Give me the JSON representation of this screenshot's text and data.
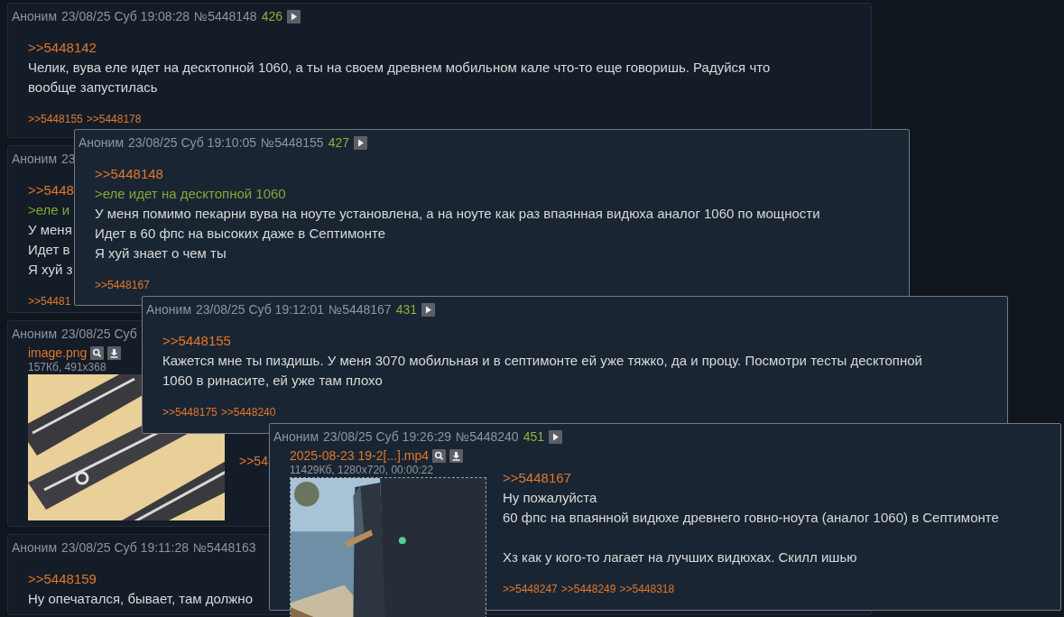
{
  "thread": [
    {
      "author": "Аноним",
      "datetime": "23/08/25 Суб 19:08:28",
      "number": "№5448148",
      "ordinal": "426",
      "reply_to": ">>5448142",
      "lines": [
        {
          "kind": "text",
          "text": "Челик, вува еле идет на десктопной 1060, а ты на своем древнем мобильном кале что-то еще говоришь. Радуйся что вообще запустилась"
        }
      ],
      "backlinks": [
        ">>5448155",
        ">>5448178"
      ]
    },
    {
      "author": "Аноним",
      "datetime": "23",
      "reply_to": ">>5448",
      "lines": [
        {
          "kind": "quote",
          "text": ">еле и"
        },
        {
          "kind": "text",
          "text": "У меня"
        },
        {
          "kind": "text",
          "text": "Идет в"
        },
        {
          "kind": "text",
          "text": "Я хуй з"
        }
      ],
      "backlinks": [
        ">>54481"
      ]
    },
    {
      "author": "Аноним",
      "datetime": "23/08/25 Суб",
      "file": {
        "name": "image.png",
        "meta": "157Кб, 491x368"
      },
      "reply_to": ">>54"
    },
    {
      "author": "Аноним",
      "datetime": "23/08/25 Суб 19:11:28",
      "number": "№5448163",
      "reply_to": ">>5448159",
      "lines": [
        {
          "kind": "text",
          "text": "Ну опечатался, бывает, там должно"
        }
      ]
    }
  ],
  "previews": [
    {
      "author": "Аноним",
      "datetime": "23/08/25 Суб 19:10:05",
      "number": "№5448155",
      "ordinal": "427",
      "reply_to": ">>5448148",
      "lines": [
        {
          "kind": "quote",
          "text": ">еле идет на десктопной 1060"
        },
        {
          "kind": "text",
          "text": "У меня помимо пекарни вува на ноуте установлена, а на ноуте как раз впаянная видюха аналог 1060 по мощности"
        },
        {
          "kind": "text",
          "text": "Идет в 60 фпс на высоких даже в Септимонте"
        },
        {
          "kind": "text",
          "text": "Я хуй знает о чем ты"
        }
      ],
      "backlinks": [
        ">>5448167"
      ]
    },
    {
      "author": "Аноним",
      "datetime": "23/08/25 Суб 19:12:01",
      "number": "№5448167",
      "ordinal": "431",
      "reply_to": ">>5448155",
      "lines": [
        {
          "kind": "text",
          "text": "Кажется мне ты пиздишь. У меня 3070 мобильная и в септимонте ей уже тяжко, да и процу. Посмотри тесты десктопной 1060 в ринасите, ей уже там плохо"
        }
      ],
      "backlinks": [
        ">>5448175",
        ">>5448240"
      ]
    },
    {
      "author": "Аноним",
      "datetime": "23/08/25 Суб 19:26:29",
      "number": "№5448240",
      "ordinal": "451",
      "file": {
        "kind": "video",
        "name": "2025-08-23 19-2[...].mp4",
        "meta": "11429Кб, 1280x720, 00:00:22"
      },
      "reply_to": ">>5448167",
      "lines": [
        {
          "kind": "text",
          "text": "Ну пожалуйста"
        },
        {
          "kind": "text",
          "text": "60 фпс на впаянной видюхе древнего говно-ноута (аналог 1060) в Септимонте"
        },
        {
          "kind": "blank"
        },
        {
          "kind": "text",
          "text": "Хз как у кого-то лагает на лучших видюхах. Скилл ишью"
        }
      ],
      "backlinks": [
        ">>5448247",
        ">>5448249",
        ">>5448318"
      ]
    }
  ]
}
